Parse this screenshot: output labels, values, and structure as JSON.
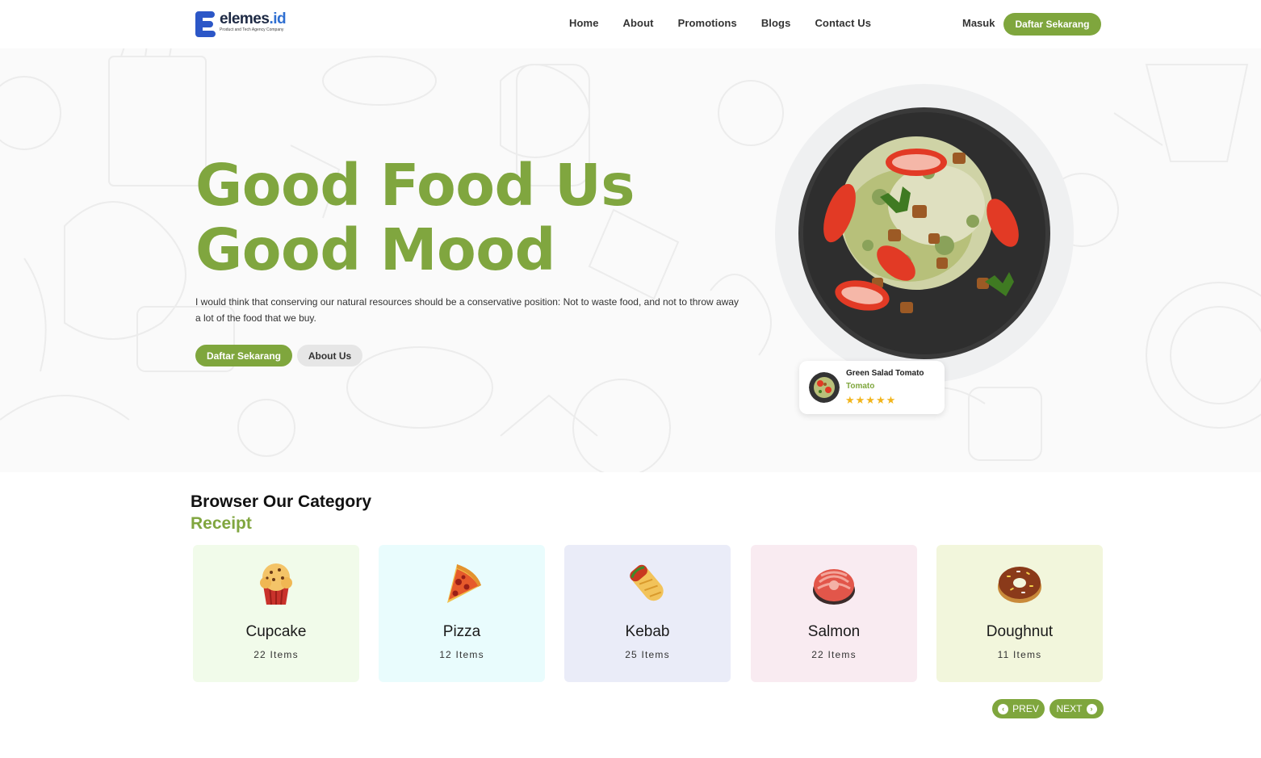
{
  "brand": {
    "name": "elemes",
    "tld": ".id",
    "tagline": "Product and Tech Agency Company"
  },
  "nav": [
    {
      "label": "Home"
    },
    {
      "label": "About"
    },
    {
      "label": "Promotions"
    },
    {
      "label": "Blogs"
    },
    {
      "label": "Contact Us"
    }
  ],
  "auth": {
    "login_label": "Masuk",
    "register_label": "Daftar Sekarang"
  },
  "hero": {
    "title_line1": "Good Food Us",
    "title_line2": "Good Mood",
    "description": "I would think that conserving our natural resources should be a conservative position: Not to waste food, and not to throw away a lot of the food that we buy.",
    "primary_button": "Daftar Sekarang",
    "secondary_button": "About Us"
  },
  "featured_dish": {
    "name": "Green Salad Tomato",
    "subtitle": "Tomato",
    "rating": 5,
    "stars": "★★★★★"
  },
  "categories": {
    "title": "Browser Our Category",
    "subtitle": "Receipt",
    "items": [
      {
        "name": "Cupcake",
        "count": "22 Items",
        "bg": "#f1fbea",
        "icon": "cupcake-icon"
      },
      {
        "name": "Pizza",
        "count": "12 Items",
        "bg": "#e9fcfd",
        "icon": "pizza-icon"
      },
      {
        "name": "Kebab",
        "count": "25 Items",
        "bg": "#eaecf8",
        "icon": "kebab-icon"
      },
      {
        "name": "Salmon",
        "count": "22 Items",
        "bg": "#f9ebf1",
        "icon": "salmon-icon"
      },
      {
        "name": "Doughnut",
        "count": "11 Items",
        "bg": "#f2f6dc",
        "icon": "doughnut-icon"
      }
    ],
    "prev_label": "PREV",
    "next_label": "NEXT"
  },
  "colors": {
    "accent": "#7fa63d",
    "heading_green": "#80a63f",
    "star": "#f2b51c"
  }
}
